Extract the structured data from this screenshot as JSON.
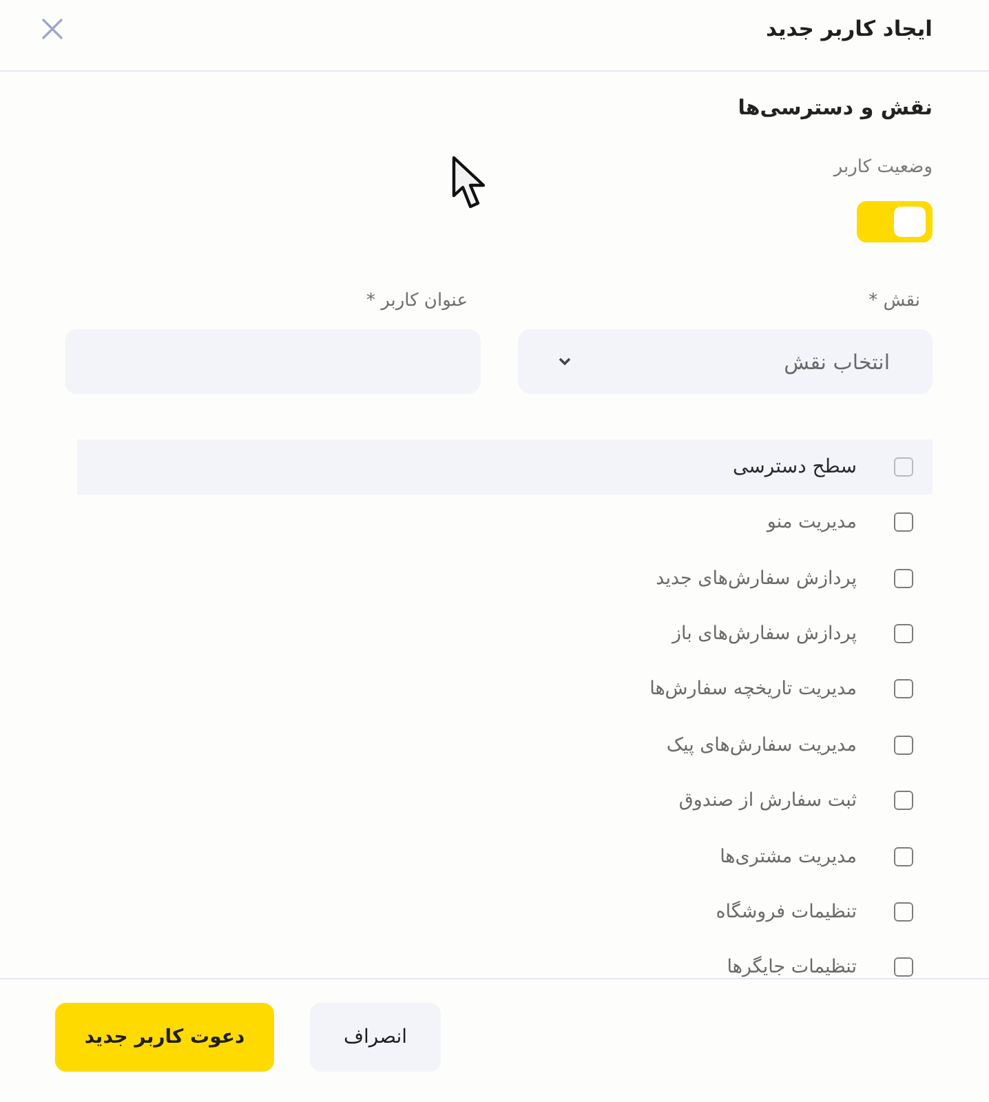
{
  "dialog": {
    "title": "ایجاد کاربر جدید"
  },
  "section": {
    "heading": "نقش و دسترسی‌ها"
  },
  "status": {
    "label": "وضعیت کاربر",
    "on": true
  },
  "fields": [
    {
      "kind": "select",
      "label": "نقش *",
      "placeholder": "انتخاب نقش"
    },
    {
      "kind": "input",
      "label": "عنوان کاربر *"
    }
  ],
  "permissions": {
    "header": {
      "label": "سطح دسترسی",
      "checked": false
    },
    "items": [
      {
        "label": "مدیریت منو",
        "checked": false
      },
      {
        "label": "پردازش سفارش‌های جدید",
        "checked": false
      },
      {
        "label": "پردازش سفارش‌های باز",
        "checked": false
      },
      {
        "label": "مدیریت تاریخچه سفارش‌ها",
        "checked": false
      },
      {
        "label": "مدیریت سفارش‌های پیک",
        "checked": false
      },
      {
        "label": "ثبت سفارش از صندوق",
        "checked": false
      },
      {
        "label": "مدیریت مشتری‌ها",
        "checked": false
      },
      {
        "label": "تنظیمات فروشگاه",
        "checked": false
      },
      {
        "label": "تنظیمات جایگرها",
        "checked": false
      }
    ]
  },
  "buttons": [
    {
      "kind": "secondary",
      "label": "انصراف"
    },
    {
      "kind": "primary",
      "label": "دعوت کاربر جدید"
    }
  ]
}
